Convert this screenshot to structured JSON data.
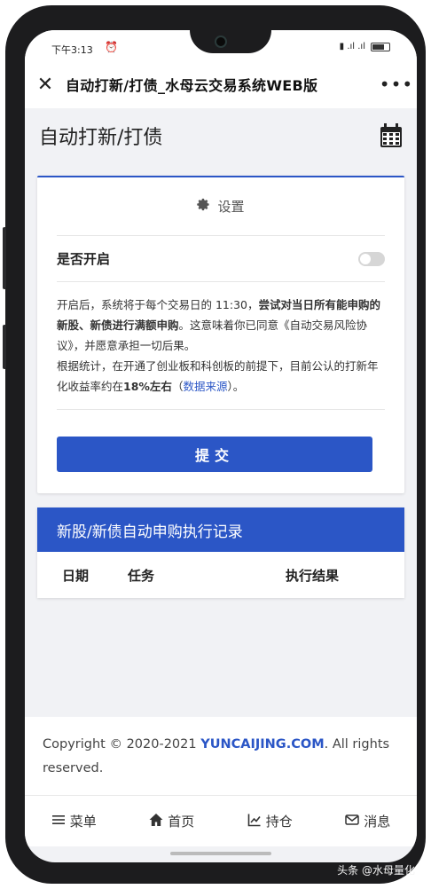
{
  "statusbar": {
    "time": "下午3:13",
    "alarm_icon": "alarm-icon",
    "signal_text": "⬛ .ıl .ıl",
    "battery": "battery-icon"
  },
  "titlebar": {
    "close_icon": "close-icon",
    "title": "自动打新/打债_水母云交易系统WEB版",
    "more_icon": "more-icon"
  },
  "page": {
    "title": "自动打新/打债",
    "calendar_icon": "calendar-icon"
  },
  "settings_card": {
    "header_icon": "gear-icon",
    "header": "设置",
    "switch_label": "是否开启",
    "switch_on": false,
    "desc_line1_a": "开启后，系统将于每个交易日的 11:30，",
    "desc_line1_b": "尝试对当日所有能申购的新股、新债进行满额申购",
    "desc_line1_c": "。这意味着你已同意《自动交易风险协议》，并愿意承担一切后果。",
    "desc_line2_a": "根据统计，在开通了创业板和科创板的前提下，目前公认的打新年化收益率约在",
    "desc_line2_b": "18%左右",
    "desc_line2_c": "（",
    "desc_link": "数据来源",
    "desc_line2_d": "）。",
    "submit": "提交"
  },
  "records": {
    "title": "新股/新债自动申购执行记录",
    "columns": [
      "日期",
      "任务",
      "执行结果"
    ]
  },
  "footer": {
    "copyright": "Copyright © 2020-2021 ",
    "brand": "YUNCAIJING.COM",
    "rest": ". All rights reserved."
  },
  "tabbar": [
    {
      "icon": "menu-icon",
      "label": "菜单"
    },
    {
      "icon": "home-icon",
      "label": "首页"
    },
    {
      "icon": "chart-icon",
      "label": "持仓"
    },
    {
      "icon": "mail-icon",
      "label": "消息"
    }
  ],
  "watermark": "头条 @水母量化",
  "colors": {
    "accent": "#2b56c6",
    "background": "#f1f2f5"
  }
}
